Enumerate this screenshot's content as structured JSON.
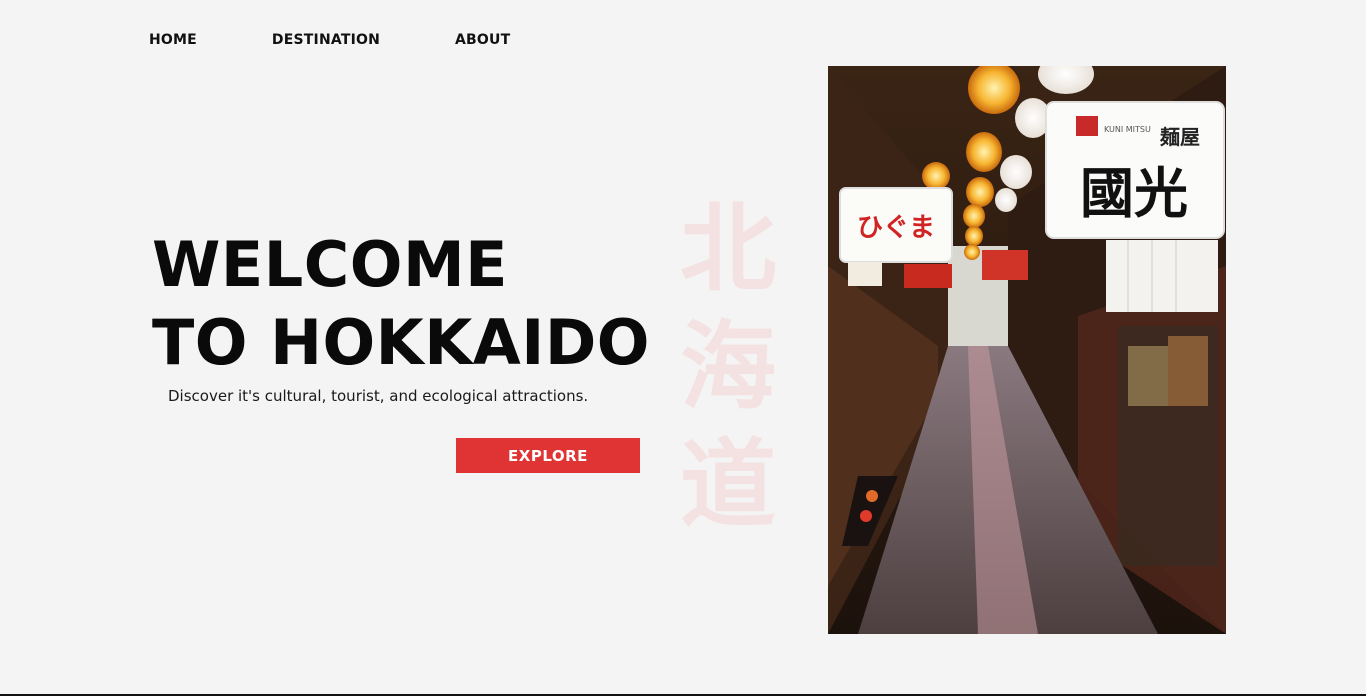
{
  "nav": {
    "items": [
      {
        "label": "HOME"
      },
      {
        "label": "DESTINATION"
      },
      {
        "label": "ABOUT"
      }
    ]
  },
  "hero": {
    "title_line1": "WELCOME",
    "title_line2": "TO HOKKAIDO",
    "subtitle": "Discover it's cultural, tourist, and ecological attractions.",
    "cta_label": "EXPLORE",
    "watermark": [
      "北",
      "海",
      "道"
    ]
  },
  "photo": {
    "sign_left": "ひぐま",
    "sign_right_top_left": "KUNI MITSU",
    "sign_right_top_right": "麺屋",
    "sign_right_main": "國光"
  },
  "colors": {
    "background": "#f4f4f4",
    "accent": "#e03434",
    "watermark": "#f4e2e2",
    "text": "#111111"
  }
}
